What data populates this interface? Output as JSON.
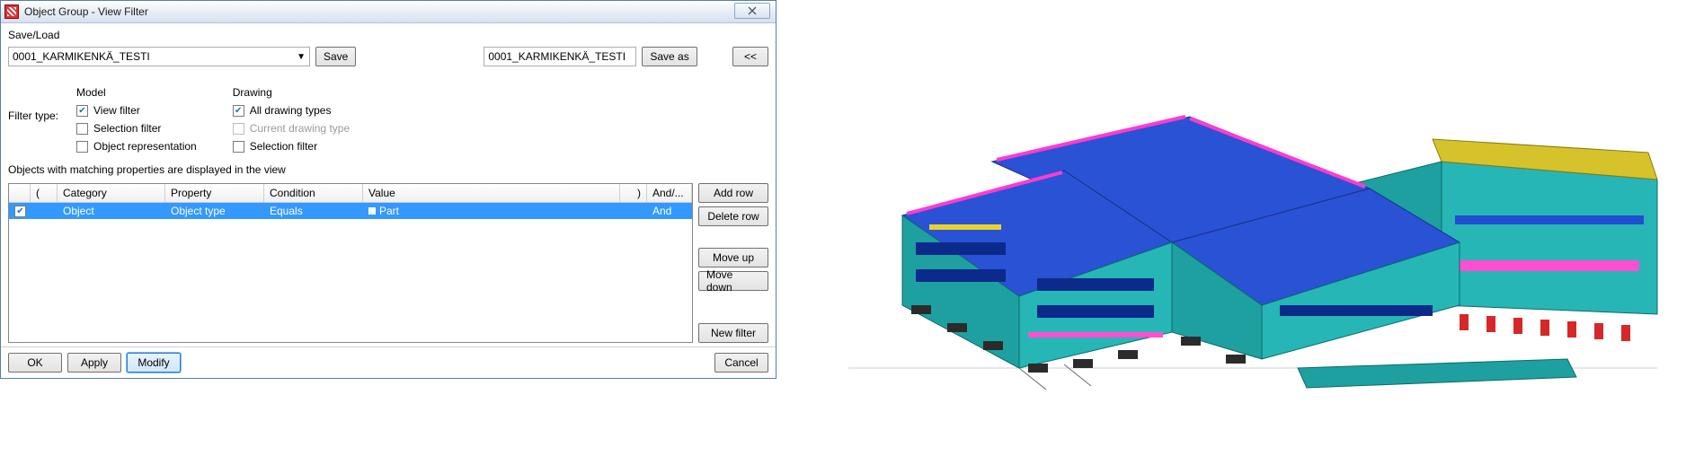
{
  "window": {
    "title": "Object Group - View Filter"
  },
  "saveload": {
    "label": "Save/Load",
    "preset": "0001_KARMIKENKÄ_TESTI",
    "save_btn": "Save",
    "name_value": "0001_KARMIKENKÄ_TESTI",
    "saveas_btn": "Save as",
    "collapse_btn": "<<"
  },
  "filter": {
    "type_label": "Filter type:",
    "model_label": "Model",
    "drawing_label": "Drawing",
    "view_filter": "View filter",
    "selection_filter": "Selection filter",
    "object_repr": "Object representation",
    "all_drawing": "All drawing types",
    "current_drawing": "Current drawing type",
    "drawing_selection": "Selection filter"
  },
  "description": "Objects with matching properties are displayed in the view",
  "table": {
    "headers": {
      "paren_open": "(",
      "category": "Category",
      "property": "Property",
      "condition": "Condition",
      "value": "Value",
      "paren_close": ")",
      "andor": "And/..."
    },
    "row": {
      "category": "Object",
      "property": "Object type",
      "condition": "Equals",
      "value": "Part",
      "andor": "And"
    }
  },
  "buttons": {
    "add_row": "Add row",
    "delete_row": "Delete row",
    "move_up": "Move up",
    "move_down": "Move down",
    "new_filter": "New filter",
    "ok": "OK",
    "apply": "Apply",
    "modify": "Modify",
    "cancel": "Cancel"
  }
}
